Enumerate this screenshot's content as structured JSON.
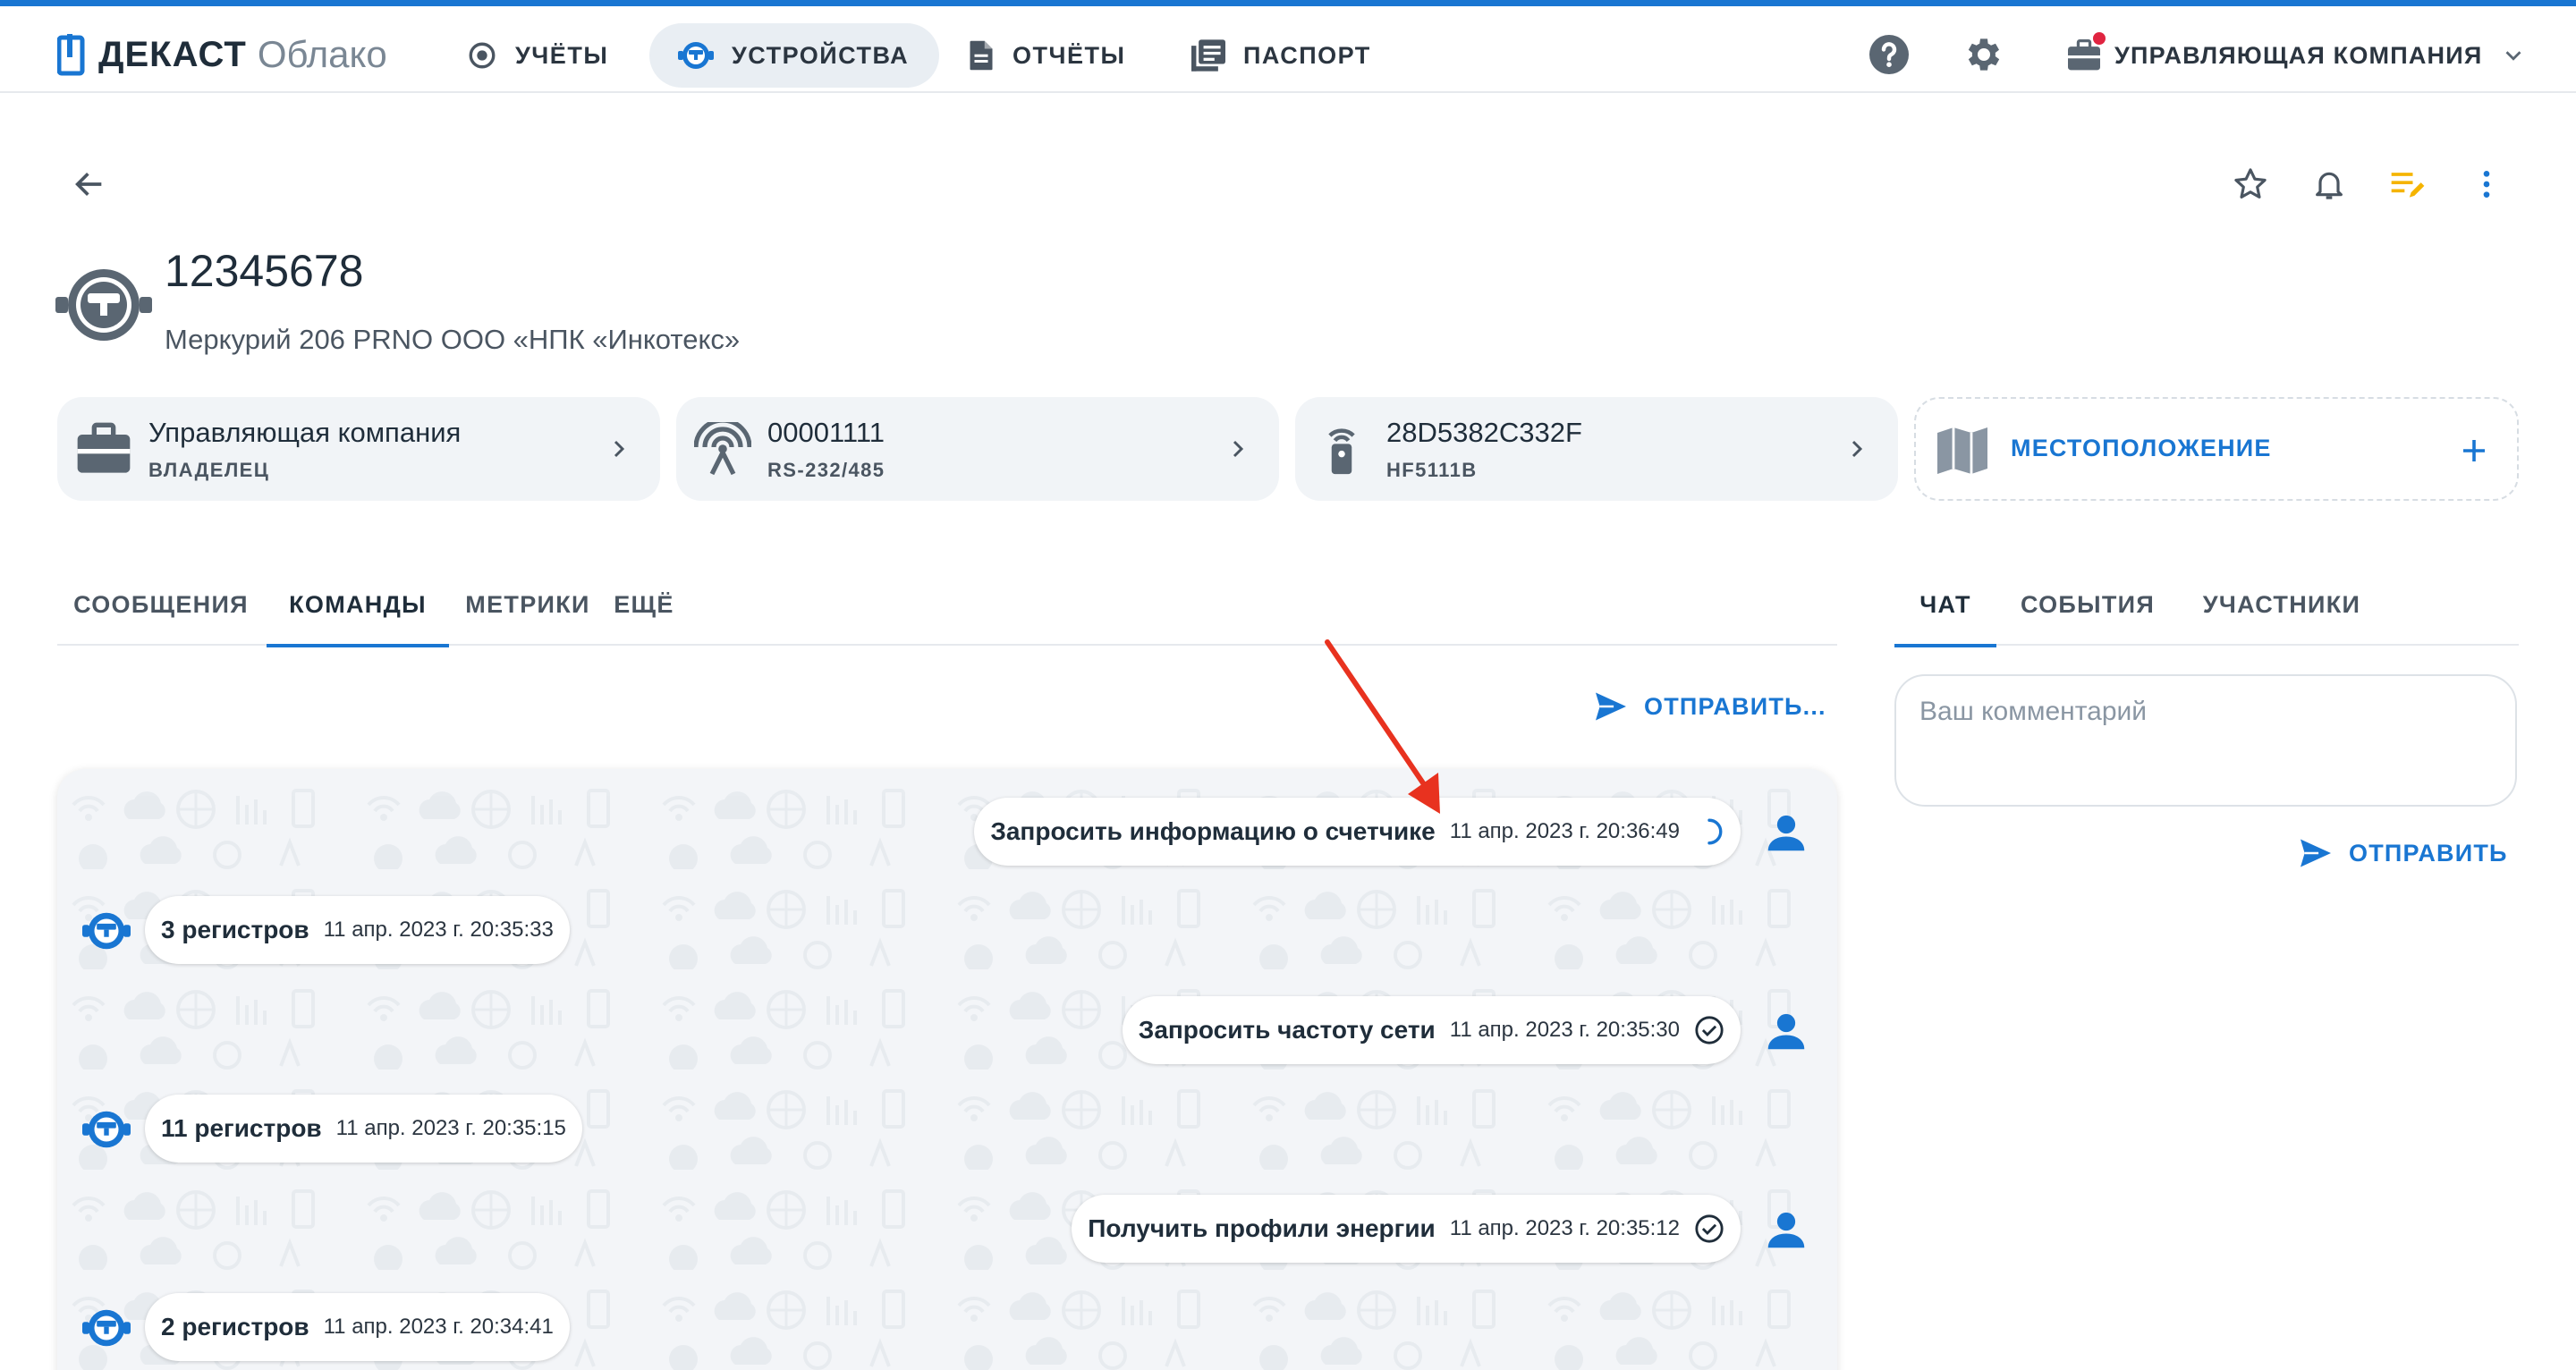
{
  "app": {
    "brand_strong": "ДЕКАСТ",
    "brand_light": "Облако"
  },
  "nav": {
    "items": [
      {
        "label": "УЧЁТЫ",
        "icon": "aperture-icon"
      },
      {
        "label": "УСТРОЙСТВА",
        "icon": "meter-icon",
        "active": true
      },
      {
        "label": "ОТЧЁТЫ",
        "icon": "document-icon"
      },
      {
        "label": "ПАСПОРТ",
        "icon": "library-icon"
      }
    ],
    "company": "УПРАВЛЯЮЩАЯ КОМПАНИЯ"
  },
  "device": {
    "title": "12345678",
    "subtitle": "Меркурий 206 PRNO ООО «НПК «Инкотекс»"
  },
  "cards": [
    {
      "main": "Управляющая компания",
      "sub": "ВЛАДЕЛЕЦ",
      "icon": "briefcase-icon"
    },
    {
      "main": "00001111",
      "sub": "RS-232/485",
      "icon": "antenna-icon"
    },
    {
      "main": "28D5382C332F",
      "sub": "HF5111B",
      "icon": "remote-icon"
    },
    {
      "label": "МЕСТОПОЛОЖЕНИЕ",
      "icon": "map-icon"
    }
  ],
  "tabs_left": [
    {
      "label": "СООБЩЕНИЯ"
    },
    {
      "label": "КОМАНДЫ",
      "active": true
    },
    {
      "label": "МЕТРИКИ"
    },
    {
      "label": "ЕЩЁ"
    }
  ],
  "tabs_right": [
    {
      "label": "ЧАТ",
      "active": true
    },
    {
      "label": "СОБЫТИЯ"
    },
    {
      "label": "УЧАСТНИКИ"
    }
  ],
  "commands": {
    "send_label": "ОТПРАВИТЬ...",
    "messages": [
      {
        "text": "Запросить информацию о счетчике",
        "time": "11 апр. 2023 г. 20:36:49",
        "side": "out",
        "status": "pending"
      },
      {
        "text": "3 регистров",
        "time": "11 апр. 2023 г. 20:35:33",
        "side": "in"
      },
      {
        "text": "Запросить частоту сети",
        "time": "11 апр. 2023 г. 20:35:30",
        "side": "out",
        "status": "done"
      },
      {
        "text": "11 регистров",
        "time": "11 апр. 2023 г. 20:35:15",
        "side": "in"
      },
      {
        "text": "Получить профили энергии",
        "time": "11 апр. 2023 г. 20:35:12",
        "side": "out",
        "status": "done"
      },
      {
        "text": "2 регистров",
        "time": "11 апр. 2023 г. 20:34:41",
        "side": "in"
      }
    ]
  },
  "chat": {
    "placeholder": "Ваш комментарий",
    "send_label": "ОТПРАВИТЬ"
  },
  "colors": {
    "accent": "#1976d2",
    "annotation_arrow": "#e8321f",
    "notification_badge": "#e02440",
    "edit_icon": "#f5b400"
  }
}
